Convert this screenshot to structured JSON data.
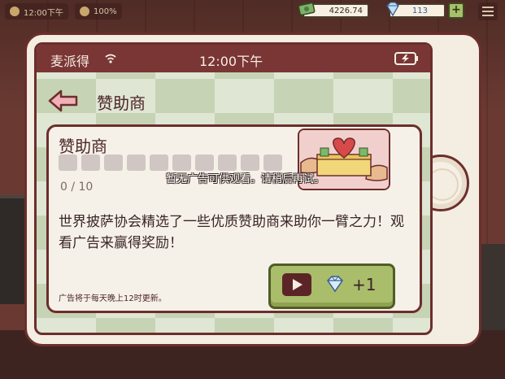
{
  "hud": {
    "time": "12:00下午",
    "mood": "100%",
    "cash": "4226.74",
    "gems": "113",
    "plus_label": "+"
  },
  "phone": {
    "status_bar": {
      "carrier": "麦派得",
      "clock": "12:00下午"
    },
    "page_title": "赞助商",
    "card": {
      "title": "赞助商",
      "progress": {
        "current": 0,
        "total": 10,
        "label": "0 / 10"
      },
      "toast": "暂无广告可供观看。请稍后再试。",
      "description": "世界披萨协会精选了一些优质赞助商来助你一臂之力！观看广告来赢得奖励！",
      "footer_note": "广告将于每天晚上12时更新。",
      "watch_button": {
        "icon": "play-icon",
        "reward": "+1",
        "reward_icon": "gem-icon"
      }
    }
  },
  "colors": {
    "frame": "#6b2e2c",
    "status_bar": "#7a3535",
    "button_green": "#a9bd6b",
    "checker_light": "#dfe6d3",
    "checker_dark": "#c7d3b5"
  }
}
